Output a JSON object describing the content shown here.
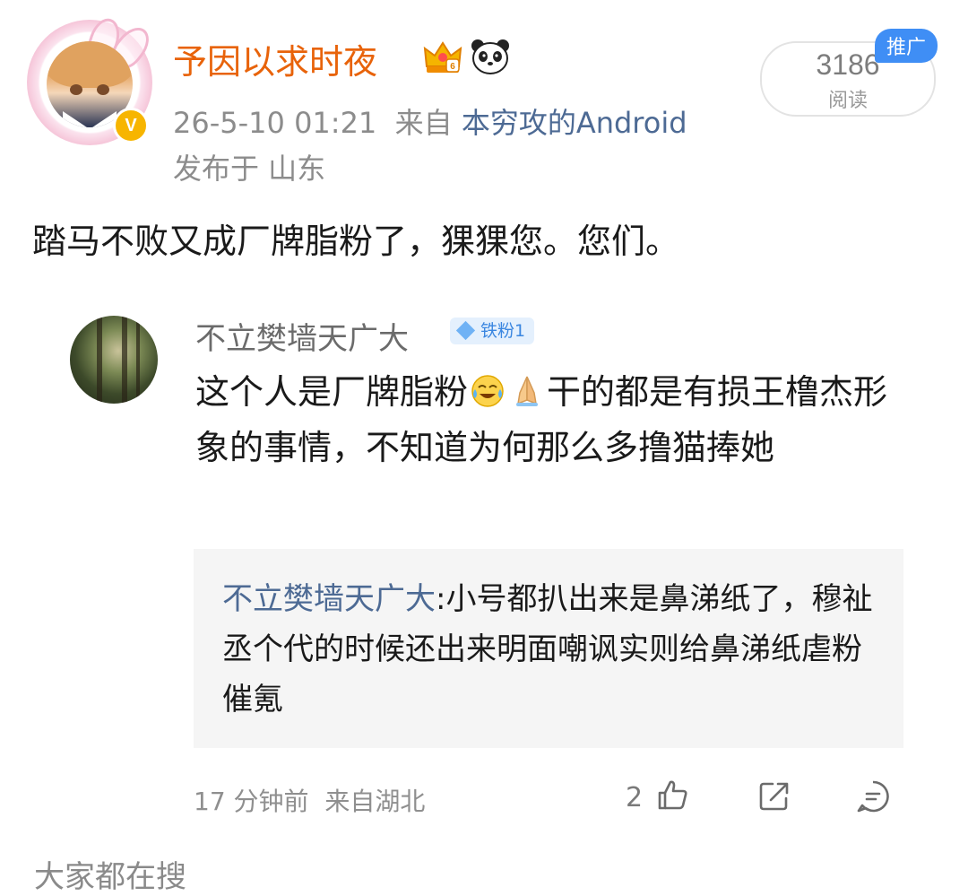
{
  "post": {
    "username": "予因以求时夜",
    "timestamp": "26-5-10 01:21",
    "source_prefix": "来自",
    "source_app": "本穷攻的Android",
    "location": "发布于 山东",
    "text": "踏马不败又成厂牌脂粉了，猓猓您。您们。",
    "read_count": "3186",
    "read_label": "阅读",
    "promo_badge": "推广",
    "icons": [
      "crown-icon",
      "panda-icon",
      "verified-icon"
    ],
    "colors": {
      "username": "#e8630a",
      "link": "#4d6a94",
      "badge": "#3f8ef5",
      "verified": "#f7b500"
    }
  },
  "comment": {
    "name": "不立樊墙天广大",
    "fan_badge": "铁粉1",
    "text_part1": "这个人是厂牌脂粉",
    "text_part2": "干的都是有损王橹杰形象的事情，不知道为何那么多撸猫捧她",
    "reply": {
      "name": "不立樊墙天广大",
      "sep": ":",
      "text": "小号都扒出来是鼻涕纸了，穆祉丞个代的时候还出来明面嘲讽实则给鼻涕纸虐粉催氪"
    },
    "time": "17 分钟前",
    "location": "来自湖北",
    "like_count": "2",
    "icons": [
      "laugh-cry-emoji",
      "pray-hands-emoji",
      "like-icon",
      "share-icon",
      "comment-icon"
    ]
  },
  "footer": {
    "trending_label": "大家都在搜"
  }
}
